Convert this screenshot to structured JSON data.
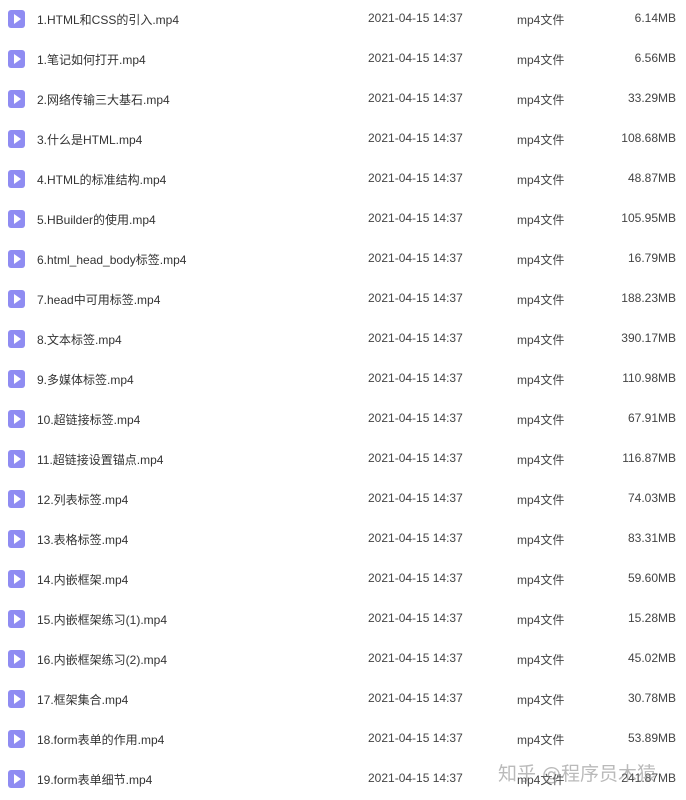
{
  "colors": {
    "file_icon": "#8f8cf2",
    "text": "#333333"
  },
  "files": [
    {
      "name": "1.HTML和CSS的引入.mp4",
      "date": "2021-04-15 14:37",
      "type": "mp4文件",
      "size": "6.14MB",
      "icon": "video-file-icon"
    },
    {
      "name": "1.笔记如何打开.mp4",
      "date": "2021-04-15 14:37",
      "type": "mp4文件",
      "size": "6.56MB",
      "icon": "video-file-icon"
    },
    {
      "name": "2.网络传输三大基石.mp4",
      "date": "2021-04-15 14:37",
      "type": "mp4文件",
      "size": "33.29MB",
      "icon": "video-file-icon"
    },
    {
      "name": "3.什么是HTML.mp4",
      "date": "2021-04-15 14:37",
      "type": "mp4文件",
      "size": "108.68MB",
      "icon": "video-file-icon"
    },
    {
      "name": "4.HTML的标准结构.mp4",
      "date": "2021-04-15 14:37",
      "type": "mp4文件",
      "size": "48.87MB",
      "icon": "video-file-icon"
    },
    {
      "name": "5.HBuilder的使用.mp4",
      "date": "2021-04-15 14:37",
      "type": "mp4文件",
      "size": "105.95MB",
      "icon": "video-file-icon"
    },
    {
      "name": "6.html_head_body标签.mp4",
      "date": "2021-04-15 14:37",
      "type": "mp4文件",
      "size": "16.79MB",
      "icon": "video-file-icon"
    },
    {
      "name": "7.head中可用标签.mp4",
      "date": "2021-04-15 14:37",
      "type": "mp4文件",
      "size": "188.23MB",
      "icon": "video-file-icon"
    },
    {
      "name": "8.文本标签.mp4",
      "date": "2021-04-15 14:37",
      "type": "mp4文件",
      "size": "390.17MB",
      "icon": "video-file-icon"
    },
    {
      "name": "9.多媒体标签.mp4",
      "date": "2021-04-15 14:37",
      "type": "mp4文件",
      "size": "110.98MB",
      "icon": "video-file-icon"
    },
    {
      "name": "10.超链接标签.mp4",
      "date": "2021-04-15 14:37",
      "type": "mp4文件",
      "size": "67.91MB",
      "icon": "video-file-icon"
    },
    {
      "name": "11.超链接设置锚点.mp4",
      "date": "2021-04-15 14:37",
      "type": "mp4文件",
      "size": "116.87MB",
      "icon": "video-file-icon"
    },
    {
      "name": "12.列表标签.mp4",
      "date": "2021-04-15 14:37",
      "type": "mp4文件",
      "size": "74.03MB",
      "icon": "video-file-icon"
    },
    {
      "name": "13.表格标签.mp4",
      "date": "2021-04-15 14:37",
      "type": "mp4文件",
      "size": "83.31MB",
      "icon": "video-file-icon"
    },
    {
      "name": "14.内嵌框架.mp4",
      "date": "2021-04-15 14:37",
      "type": "mp4文件",
      "size": "59.60MB",
      "icon": "video-file-icon"
    },
    {
      "name": "15.内嵌框架练习(1).mp4",
      "date": "2021-04-15 14:37",
      "type": "mp4文件",
      "size": "15.28MB",
      "icon": "video-file-icon"
    },
    {
      "name": "16.内嵌框架练习(2).mp4",
      "date": "2021-04-15 14:37",
      "type": "mp4文件",
      "size": "45.02MB",
      "icon": "video-file-icon"
    },
    {
      "name": "17.框架集合.mp4",
      "date": "2021-04-15 14:37",
      "type": "mp4文件",
      "size": "30.78MB",
      "icon": "video-file-icon"
    },
    {
      "name": "18.form表单的作用.mp4",
      "date": "2021-04-15 14:37",
      "type": "mp4文件",
      "size": "53.89MB",
      "icon": "video-file-icon"
    },
    {
      "name": "19.form表单细节.mp4",
      "date": "2021-04-15 14:37",
      "type": "mp4文件",
      "size": "241.87MB",
      "icon": "video-file-icon"
    }
  ],
  "watermark": "知乎 @程序员木猿"
}
